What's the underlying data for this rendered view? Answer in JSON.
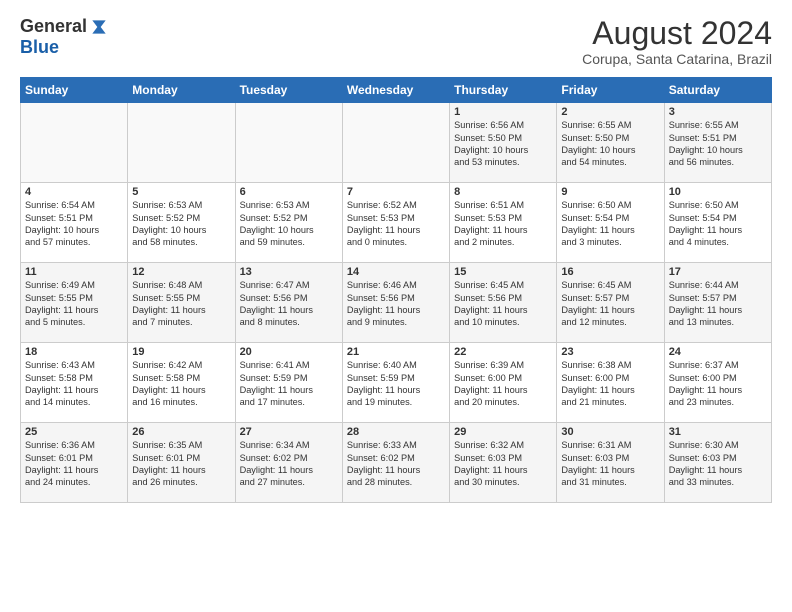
{
  "logo": {
    "general": "General",
    "blue": "Blue"
  },
  "title": "August 2024",
  "location": "Corupa, Santa Catarina, Brazil",
  "days_of_week": [
    "Sunday",
    "Monday",
    "Tuesday",
    "Wednesday",
    "Thursday",
    "Friday",
    "Saturday"
  ],
  "weeks": [
    [
      {
        "day": "",
        "info": ""
      },
      {
        "day": "",
        "info": ""
      },
      {
        "day": "",
        "info": ""
      },
      {
        "day": "",
        "info": ""
      },
      {
        "day": "1",
        "info": "Sunrise: 6:56 AM\nSunset: 5:50 PM\nDaylight: 10 hours\nand 53 minutes."
      },
      {
        "day": "2",
        "info": "Sunrise: 6:55 AM\nSunset: 5:50 PM\nDaylight: 10 hours\nand 54 minutes."
      },
      {
        "day": "3",
        "info": "Sunrise: 6:55 AM\nSunset: 5:51 PM\nDaylight: 10 hours\nand 56 minutes."
      }
    ],
    [
      {
        "day": "4",
        "info": "Sunrise: 6:54 AM\nSunset: 5:51 PM\nDaylight: 10 hours\nand 57 minutes."
      },
      {
        "day": "5",
        "info": "Sunrise: 6:53 AM\nSunset: 5:52 PM\nDaylight: 10 hours\nand 58 minutes."
      },
      {
        "day": "6",
        "info": "Sunrise: 6:53 AM\nSunset: 5:52 PM\nDaylight: 10 hours\nand 59 minutes."
      },
      {
        "day": "7",
        "info": "Sunrise: 6:52 AM\nSunset: 5:53 PM\nDaylight: 11 hours\nand 0 minutes."
      },
      {
        "day": "8",
        "info": "Sunrise: 6:51 AM\nSunset: 5:53 PM\nDaylight: 11 hours\nand 2 minutes."
      },
      {
        "day": "9",
        "info": "Sunrise: 6:50 AM\nSunset: 5:54 PM\nDaylight: 11 hours\nand 3 minutes."
      },
      {
        "day": "10",
        "info": "Sunrise: 6:50 AM\nSunset: 5:54 PM\nDaylight: 11 hours\nand 4 minutes."
      }
    ],
    [
      {
        "day": "11",
        "info": "Sunrise: 6:49 AM\nSunset: 5:55 PM\nDaylight: 11 hours\nand 5 minutes."
      },
      {
        "day": "12",
        "info": "Sunrise: 6:48 AM\nSunset: 5:55 PM\nDaylight: 11 hours\nand 7 minutes."
      },
      {
        "day": "13",
        "info": "Sunrise: 6:47 AM\nSunset: 5:56 PM\nDaylight: 11 hours\nand 8 minutes."
      },
      {
        "day": "14",
        "info": "Sunrise: 6:46 AM\nSunset: 5:56 PM\nDaylight: 11 hours\nand 9 minutes."
      },
      {
        "day": "15",
        "info": "Sunrise: 6:45 AM\nSunset: 5:56 PM\nDaylight: 11 hours\nand 10 minutes."
      },
      {
        "day": "16",
        "info": "Sunrise: 6:45 AM\nSunset: 5:57 PM\nDaylight: 11 hours\nand 12 minutes."
      },
      {
        "day": "17",
        "info": "Sunrise: 6:44 AM\nSunset: 5:57 PM\nDaylight: 11 hours\nand 13 minutes."
      }
    ],
    [
      {
        "day": "18",
        "info": "Sunrise: 6:43 AM\nSunset: 5:58 PM\nDaylight: 11 hours\nand 14 minutes."
      },
      {
        "day": "19",
        "info": "Sunrise: 6:42 AM\nSunset: 5:58 PM\nDaylight: 11 hours\nand 16 minutes."
      },
      {
        "day": "20",
        "info": "Sunrise: 6:41 AM\nSunset: 5:59 PM\nDaylight: 11 hours\nand 17 minutes."
      },
      {
        "day": "21",
        "info": "Sunrise: 6:40 AM\nSunset: 5:59 PM\nDaylight: 11 hours\nand 19 minutes."
      },
      {
        "day": "22",
        "info": "Sunrise: 6:39 AM\nSunset: 6:00 PM\nDaylight: 11 hours\nand 20 minutes."
      },
      {
        "day": "23",
        "info": "Sunrise: 6:38 AM\nSunset: 6:00 PM\nDaylight: 11 hours\nand 21 minutes."
      },
      {
        "day": "24",
        "info": "Sunrise: 6:37 AM\nSunset: 6:00 PM\nDaylight: 11 hours\nand 23 minutes."
      }
    ],
    [
      {
        "day": "25",
        "info": "Sunrise: 6:36 AM\nSunset: 6:01 PM\nDaylight: 11 hours\nand 24 minutes."
      },
      {
        "day": "26",
        "info": "Sunrise: 6:35 AM\nSunset: 6:01 PM\nDaylight: 11 hours\nand 26 minutes."
      },
      {
        "day": "27",
        "info": "Sunrise: 6:34 AM\nSunset: 6:02 PM\nDaylight: 11 hours\nand 27 minutes."
      },
      {
        "day": "28",
        "info": "Sunrise: 6:33 AM\nSunset: 6:02 PM\nDaylight: 11 hours\nand 28 minutes."
      },
      {
        "day": "29",
        "info": "Sunrise: 6:32 AM\nSunset: 6:03 PM\nDaylight: 11 hours\nand 30 minutes."
      },
      {
        "day": "30",
        "info": "Sunrise: 6:31 AM\nSunset: 6:03 PM\nDaylight: 11 hours\nand 31 minutes."
      },
      {
        "day": "31",
        "info": "Sunrise: 6:30 AM\nSunset: 6:03 PM\nDaylight: 11 hours\nand 33 minutes."
      }
    ]
  ]
}
